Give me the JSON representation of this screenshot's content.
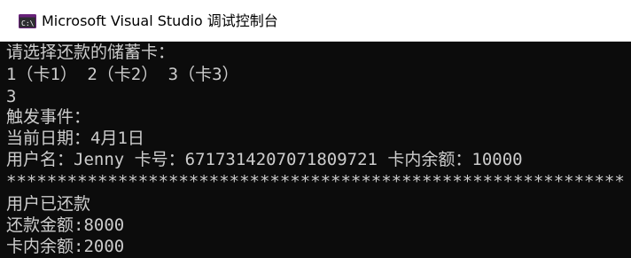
{
  "window": {
    "title": "Microsoft Visual Studio 调试控制台",
    "icon": "console-app-icon"
  },
  "console": {
    "lines": [
      "请选择还款的储蓄卡：",
      "1（卡1） 2（卡2） 3（卡3）",
      "3",
      "触发事件：",
      "当前日期：4月1日",
      "用户名：Jenny 卡号：6717314207071809721 卡内余额：10000",
      "*************************************************************",
      "用户已还款",
      "还款金额:8000",
      "卡内余额:2000"
    ],
    "text_color": "#cccccc",
    "background_color": "#0c0c0c"
  }
}
